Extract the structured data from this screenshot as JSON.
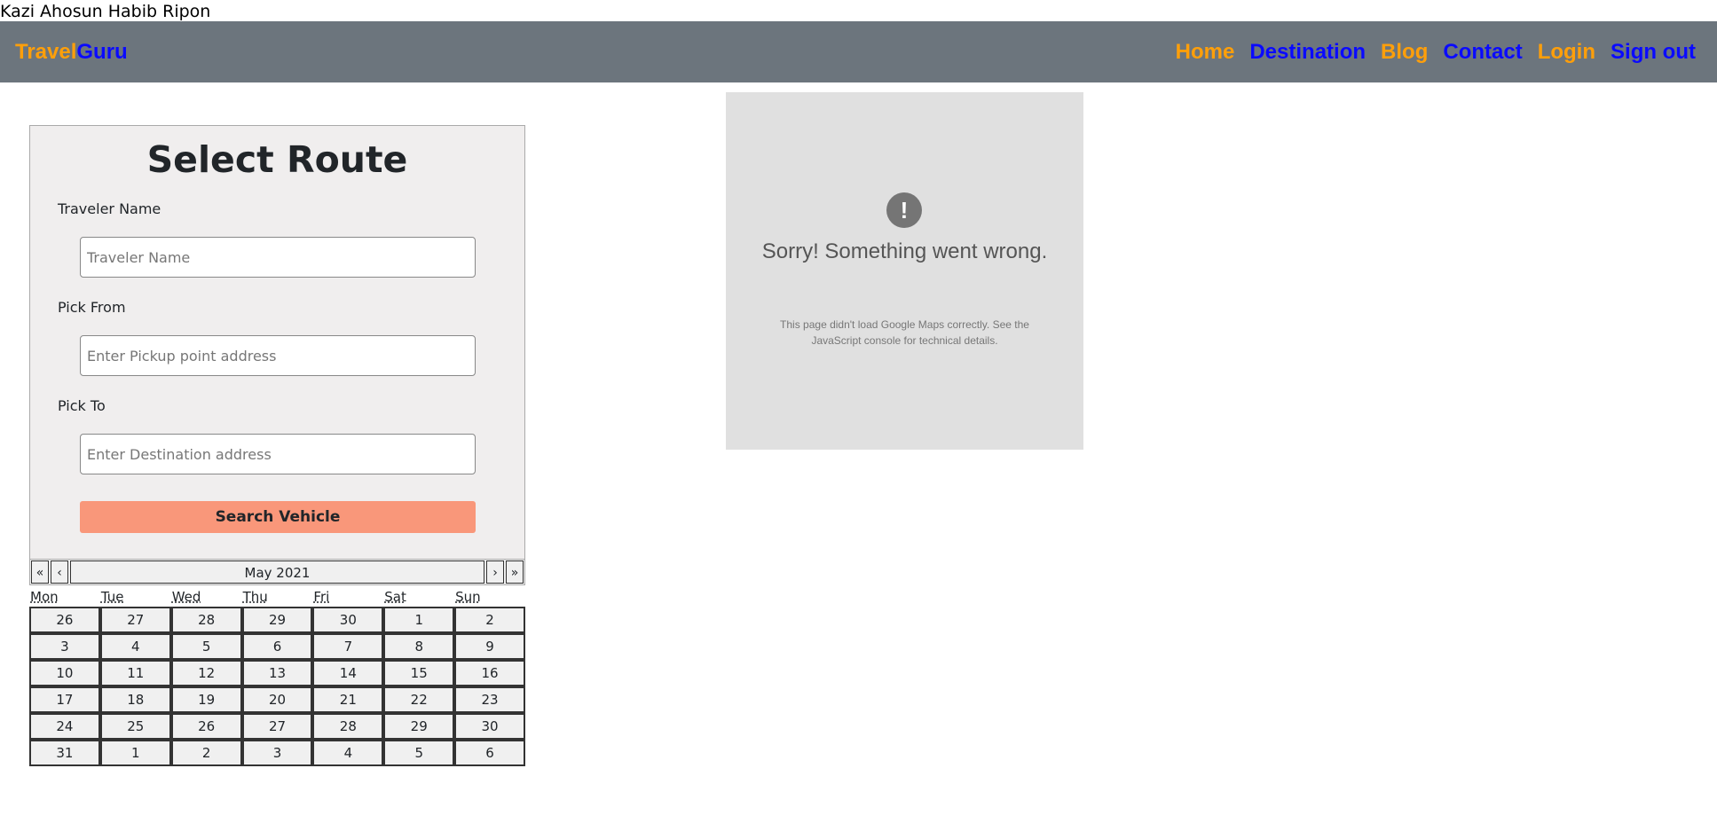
{
  "author": "Kazi Ahosun Habib Ripon",
  "navbar": {
    "brand_part1": "Travel",
    "brand_part2": "Guru",
    "links": [
      "Home",
      "Destination",
      "Blog",
      "Contact",
      "Login",
      "Sign out"
    ],
    "colors": {
      "background": "#6c757d",
      "orange": "#ff9f0a",
      "blue": "#0a0aff"
    }
  },
  "form": {
    "title": "Select Route",
    "traveler_label": "Traveler Name",
    "traveler_placeholder": "Traveler Name",
    "pick_from_label": "Pick From",
    "pick_from_placeholder": "Enter Pickup point address",
    "pick_to_label": "Pick To",
    "pick_to_placeholder": "Enter Destination address",
    "search_button": "Search Vehicle",
    "button_color": "#f9977a"
  },
  "calendar": {
    "prev_year": "«",
    "prev_month": "‹",
    "month_label": "May 2021",
    "next_month": "›",
    "next_year": "»",
    "weekdays": [
      "Mon",
      "Tue",
      "Wed",
      "Thu",
      "Fri",
      "Sat",
      "Sun"
    ],
    "weeks": [
      [
        "26",
        "27",
        "28",
        "29",
        "30",
        "1",
        "2"
      ],
      [
        "3",
        "4",
        "5",
        "6",
        "7",
        "8",
        "9"
      ],
      [
        "10",
        "11",
        "12",
        "13",
        "14",
        "15",
        "16"
      ],
      [
        "17",
        "18",
        "19",
        "20",
        "21",
        "22",
        "23"
      ],
      [
        "24",
        "25",
        "26",
        "27",
        "28",
        "29",
        "30"
      ],
      [
        "31",
        "1",
        "2",
        "3",
        "4",
        "5",
        "6"
      ]
    ]
  },
  "map_error": {
    "icon": "exclamation-icon",
    "icon_glyph": "!",
    "title": "Sorry! Something went wrong.",
    "message": "This page didn't load Google Maps correctly. See the JavaScript console for technical details."
  }
}
